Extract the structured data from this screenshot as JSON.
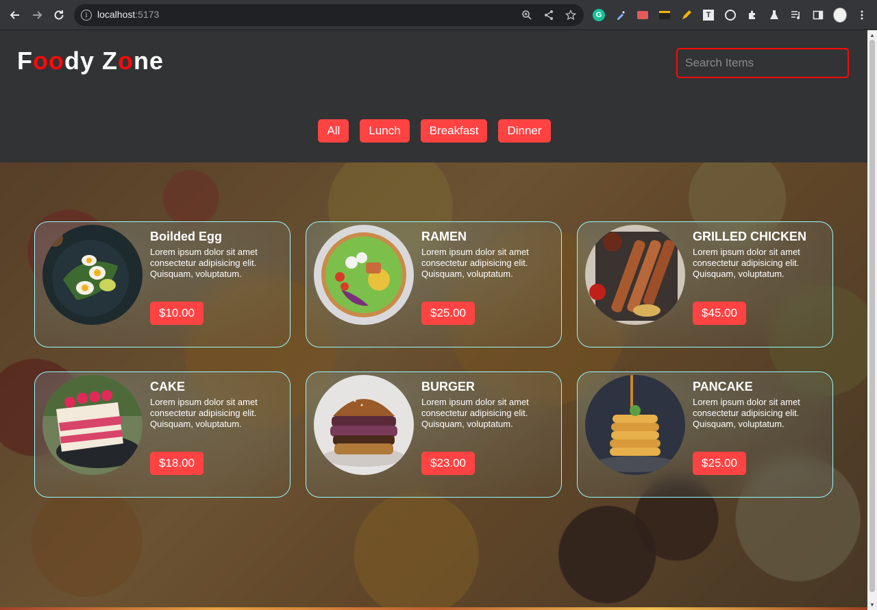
{
  "browser": {
    "url_host": "localhost",
    "url_port": ":5173"
  },
  "app": {
    "logo": {
      "letters": [
        "F",
        "o",
        "o",
        "d",
        "y",
        " ",
        "Z",
        "o",
        "n",
        "e"
      ]
    },
    "search": {
      "placeholder": "Search Items",
      "value": ""
    },
    "filters": [
      {
        "label": "All"
      },
      {
        "label": "Lunch"
      },
      {
        "label": "Breakfast"
      },
      {
        "label": "Dinner"
      }
    ],
    "cards": [
      {
        "name": "Boilded Egg",
        "description": "Lorem ipsum dolor sit amet consectetur adipisicing elit. Quisquam, voluptatum.",
        "price": "$10.00",
        "image": "boiled-egg-dish"
      },
      {
        "name": "RAMEN",
        "description": "Lorem ipsum dolor sit amet consectetur adipisicing elit. Quisquam, voluptatum.",
        "price": "$25.00",
        "image": "ramen-bowl"
      },
      {
        "name": "GRILLED CHICKEN",
        "description": "Lorem ipsum dolor sit amet consectetur adipisicing elit. Quisquam, voluptatum.",
        "price": "$45.00",
        "image": "grilled-chicken-platter"
      },
      {
        "name": "CAKE",
        "description": "Lorem ipsum dolor sit amet consectetur adipisicing elit. Quisquam, voluptatum.",
        "price": "$18.00",
        "image": "cake-slice"
      },
      {
        "name": "BURGER",
        "description": "Lorem ipsum dolor sit amet consectetur adipisicing elit. Quisquam, voluptatum.",
        "price": "$23.00",
        "image": "burger"
      },
      {
        "name": "PANCAKE",
        "description": "Lorem ipsum dolor sit amet consectetur adipisicing elit. Quisquam, voluptatum.",
        "price": "$25.00",
        "image": "pancake-stack"
      }
    ]
  },
  "colors": {
    "accent": "#ff4343",
    "logo_accent": "#ff0909",
    "card_border": "#98f9ff",
    "header_bg": "#323334"
  }
}
